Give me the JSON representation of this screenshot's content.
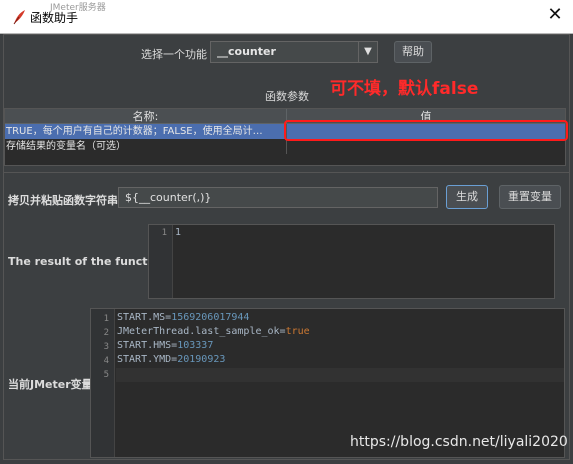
{
  "window": {
    "title": "函数助手",
    "close_glyph": "✕",
    "bleed_text": "JMeter服务器"
  },
  "function_select": {
    "label": "选择一个功能",
    "value": "__counter",
    "arrow": "▼",
    "help_button": "帮助"
  },
  "params": {
    "heading": "函数参数",
    "columns": [
      "名称:",
      "值"
    ],
    "rows": [
      {
        "name": "TRUE，每个用户有自己的计数器；FALSE，使用全局计…",
        "value": ""
      },
      {
        "name": "存储结果的变量名（可选）",
        "value": ""
      }
    ]
  },
  "annotation": {
    "text": "可不填，默认false",
    "color": "#ff2a2a"
  },
  "copy_paste": {
    "label": "拷贝并粘贴函数字符串",
    "value": "${__counter(,)}",
    "generate_button": "生成",
    "reset_button": "重置变量"
  },
  "result": {
    "label": "The result of the function is",
    "line_numbers": [
      "1"
    ],
    "lines": [
      "1"
    ]
  },
  "jmeter_vars": {
    "label": "当前JMeter变量",
    "line_numbers": [
      "1",
      "2",
      "3",
      "4",
      "5"
    ],
    "lines": [
      {
        "key": "START.MS=",
        "val": "1569206017944"
      },
      {
        "key": "JMeterThread.last_sample_ok=",
        "val": "true"
      },
      {
        "key": "START.HMS=",
        "val": "103337"
      },
      {
        "key": "START.YMD=",
        "val": "20190923"
      }
    ]
  },
  "watermark": "https://blog.csdn.net/liyali2020",
  "colors": {
    "background": "#3c3f41",
    "selection": "#4b6eaf",
    "highlight_box": "#ff1a1a"
  }
}
